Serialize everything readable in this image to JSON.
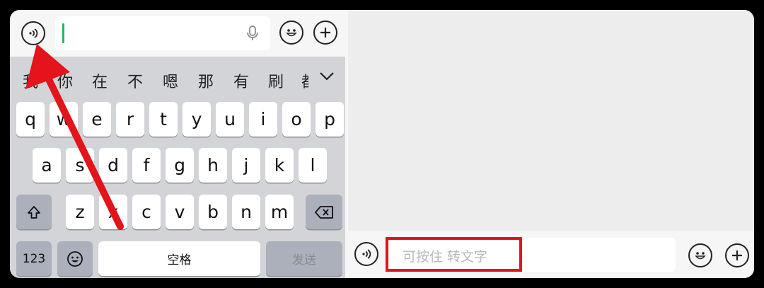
{
  "keyboard": {
    "candidates": [
      "我",
      "你",
      "在",
      "不",
      "嗯",
      "那",
      "有",
      "刷",
      "都"
    ],
    "row1": [
      "q",
      "w",
      "e",
      "r",
      "t",
      "y",
      "u",
      "i",
      "o",
      "p"
    ],
    "row2": [
      "a",
      "s",
      "d",
      "f",
      "g",
      "h",
      "j",
      "k",
      "l"
    ],
    "row3": [
      "z",
      "x",
      "c",
      "v",
      "b",
      "n",
      "m"
    ],
    "num_label": "123",
    "space_label": "空格",
    "send_label": "发送"
  },
  "chat_input": {
    "placeholder": "可按住 转文字"
  },
  "colors": {
    "annotation_red": "#e3141c",
    "cursor_green": "#2bb35e"
  }
}
